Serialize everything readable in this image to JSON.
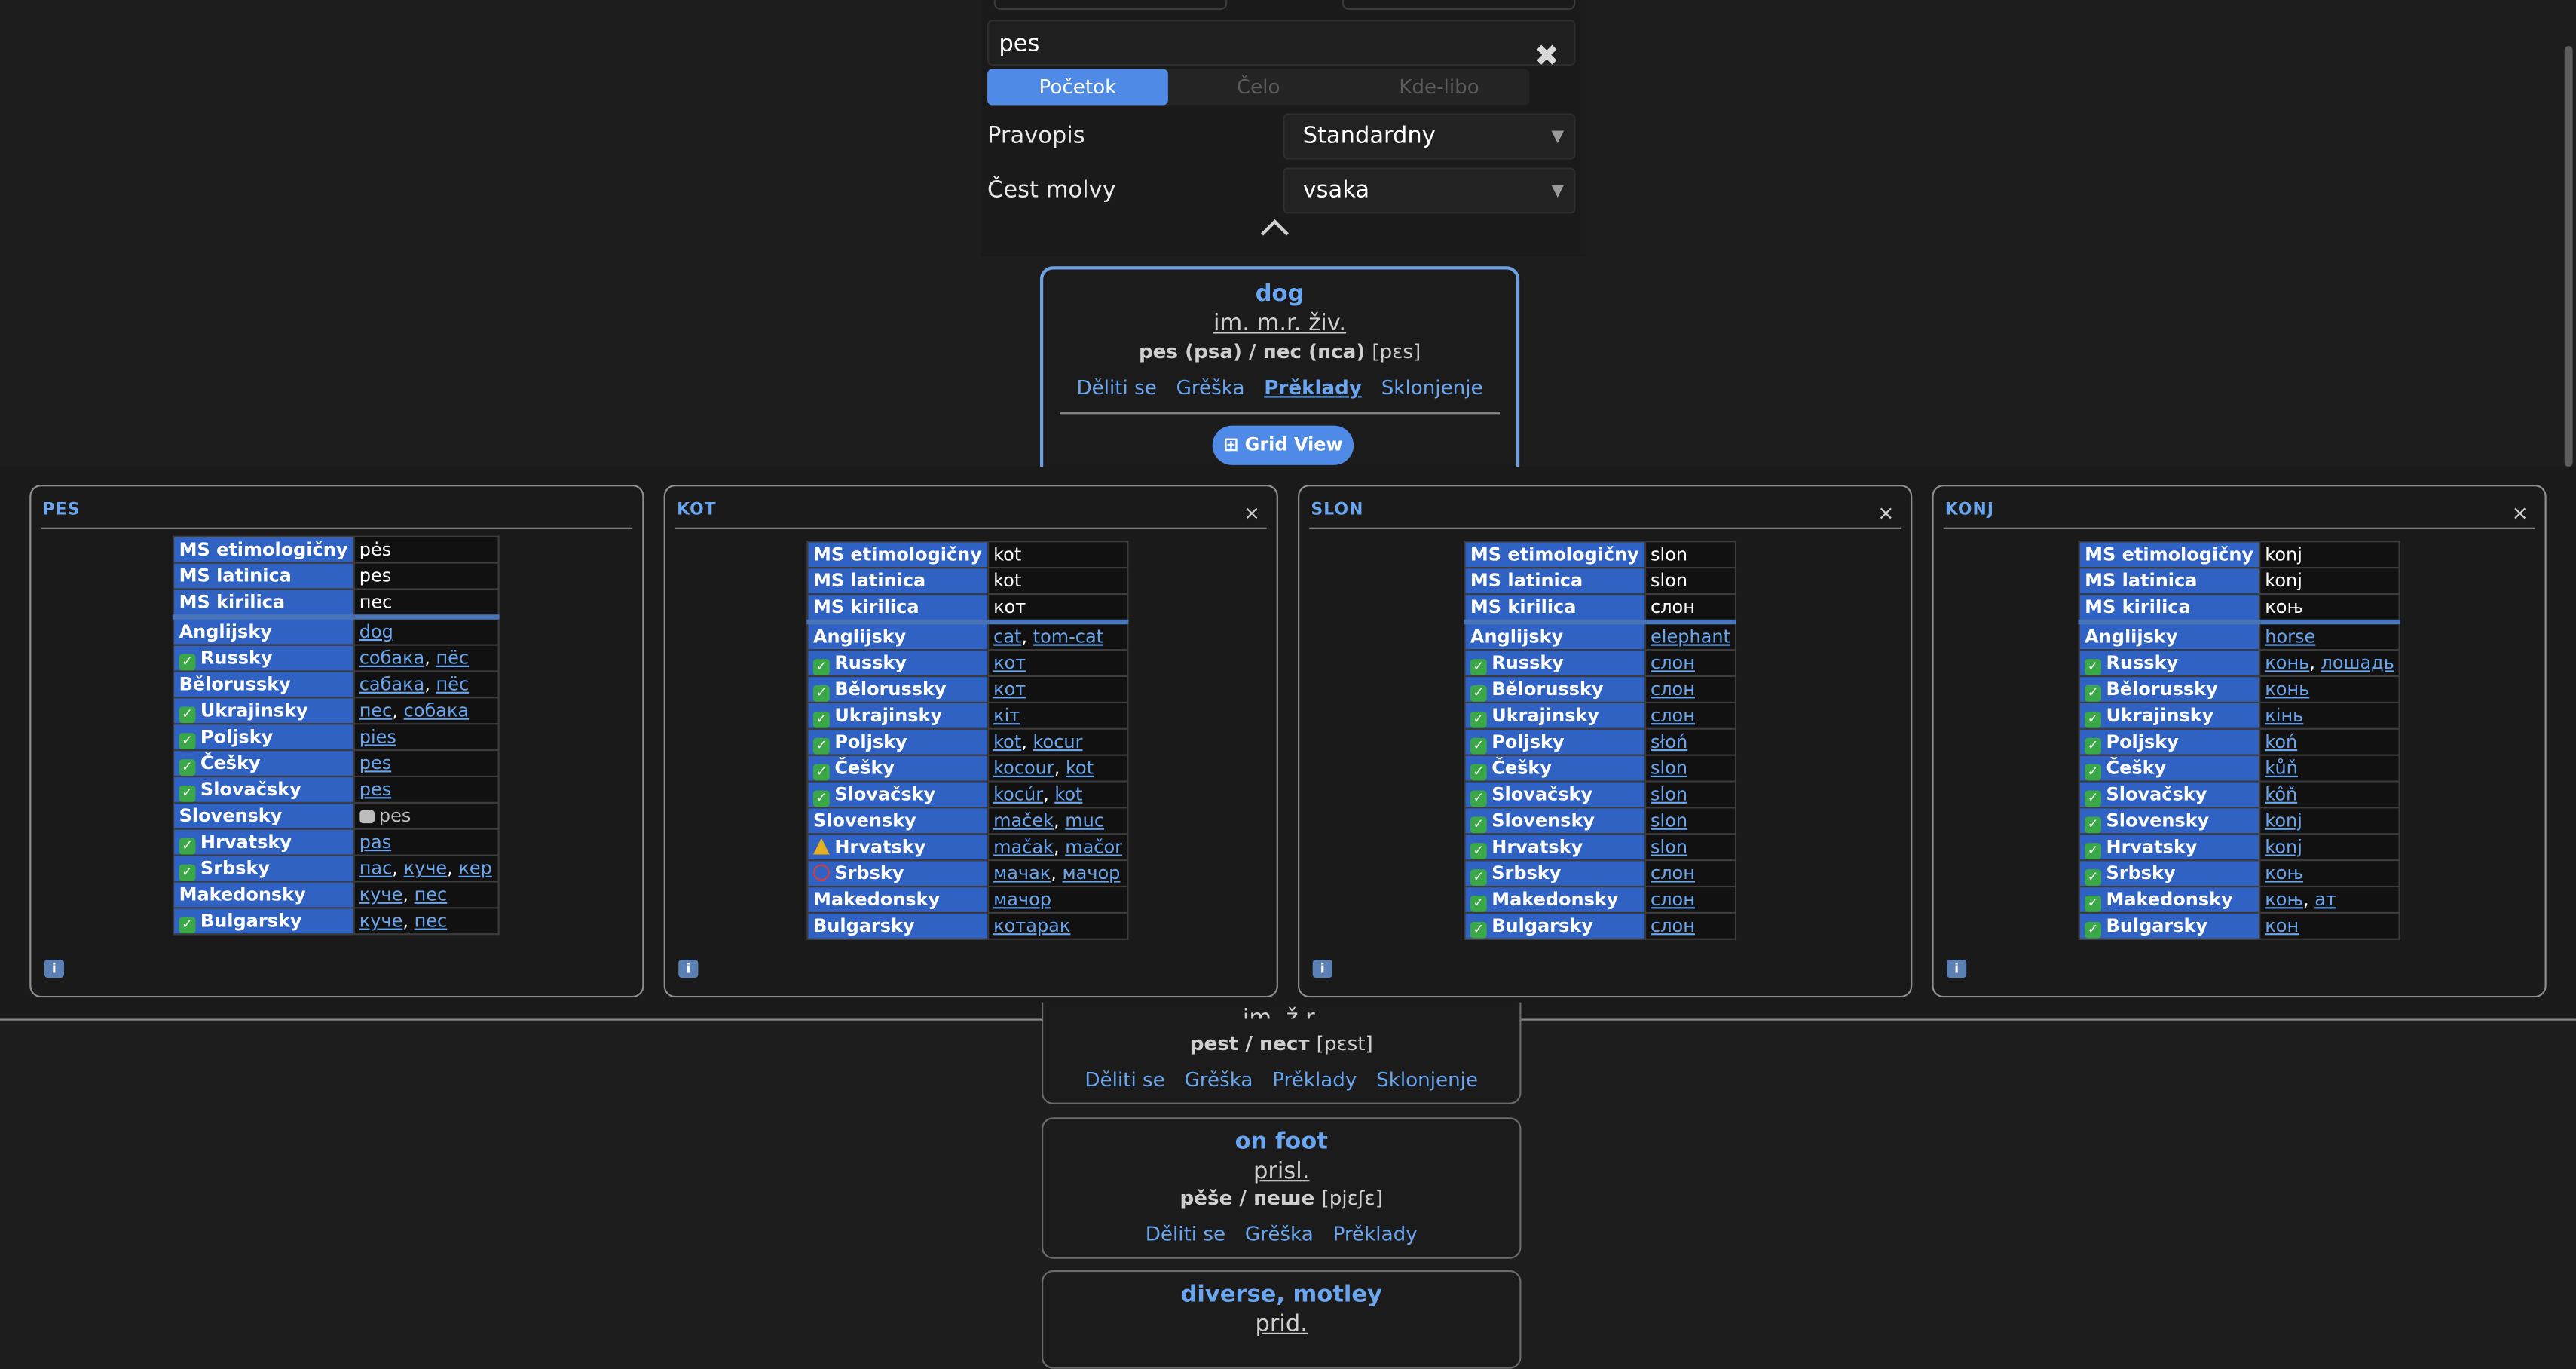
{
  "search": {
    "query": "pes",
    "modes": [
      "Početok",
      "Čelo",
      "Kde-libo"
    ]
  },
  "filters": {
    "pravopis_label": "Pravopis",
    "pravopis_value": "Standardny",
    "cest_label": "Čest molvy",
    "cest_value": "vsaka"
  },
  "colors": {
    "accent": "#4f8be6",
    "link": "#6aa6f0",
    "table_key": "#2f62c2",
    "bg": "#1d1d1d"
  },
  "cards": [
    {
      "title": "dog",
      "pos": "im. m.r. živ.",
      "forms": "pes (psa)  / пес (пса)",
      "ipa": "[pɛs]",
      "links": [
        "Děliti se",
        "Grěška",
        "Prěklady",
        "Sklonjenje"
      ],
      "grid_label": "⊞ Grid View"
    },
    {
      "title": "",
      "pos": "im. ž.r.",
      "forms": "pest  / пест",
      "ipa": "[pɛst]",
      "links": [
        "Děliti se",
        "Grěška",
        "Prěklady",
        "Sklonjenje"
      ]
    },
    {
      "title": "on foot",
      "pos": "prisl.",
      "forms": "pěše  / пеше",
      "ipa": "[pjɛʃɛ]",
      "links": [
        "Děliti se",
        "Grěška",
        "Prěklady"
      ]
    },
    {
      "title": "diverse, motley",
      "pos": "prid."
    }
  ],
  "panels": [
    {
      "name": "PES",
      "close": "",
      "head": [
        [
          "MS etimologičny",
          "pės"
        ],
        [
          "MS latinica",
          "pes"
        ],
        [
          "MS kirilica",
          "пес"
        ]
      ],
      "rows": [
        {
          "lang": "Anglijsky",
          "status": "",
          "values": [
            "dog"
          ]
        },
        {
          "lang": "Russky",
          "status": "check",
          "values": [
            "собака",
            "пёс"
          ]
        },
        {
          "lang": "Bělorussky",
          "status": "",
          "values": [
            "сабака",
            "пёс"
          ]
        },
        {
          "lang": "Ukrajinsky",
          "status": "check",
          "values": [
            "пес",
            "собака"
          ]
        },
        {
          "lang": "Poljsky",
          "status": "check",
          "values": [
            "pies"
          ]
        },
        {
          "lang": "Češky",
          "status": "check",
          "values": [
            "pes"
          ]
        },
        {
          "lang": "Slovačsky",
          "status": "check",
          "values": [
            "pes"
          ]
        },
        {
          "lang": "Slovensky",
          "status": "",
          "values": [],
          "plain": "pes"
        },
        {
          "lang": "Hrvatsky",
          "status": "check",
          "values": [
            "pas"
          ]
        },
        {
          "lang": "Srbsky",
          "status": "check",
          "values": [
            "пас",
            "куче",
            "кер"
          ]
        },
        {
          "lang": "Makedonsky",
          "status": "",
          "values": [
            "куче",
            "пес"
          ]
        },
        {
          "lang": "Bulgarsky",
          "status": "check",
          "values": [
            "куче",
            "пес"
          ]
        }
      ]
    },
    {
      "name": "KOT",
      "close": "×",
      "head": [
        [
          "MS etimologičny",
          "kot"
        ],
        [
          "MS latinica",
          "kot"
        ],
        [
          "MS kirilica",
          "кот"
        ]
      ],
      "rows": [
        {
          "lang": "Anglijsky",
          "status": "",
          "values": [
            "cat",
            "tom-cat"
          ]
        },
        {
          "lang": "Russky",
          "status": "check",
          "values": [
            "кот"
          ]
        },
        {
          "lang": "Bělorussky",
          "status": "check",
          "values": [
            "кот"
          ]
        },
        {
          "lang": "Ukrajinsky",
          "status": "check",
          "values": [
            "кіт"
          ]
        },
        {
          "lang": "Poljsky",
          "status": "check",
          "values": [
            "kot",
            "kocur"
          ]
        },
        {
          "lang": "Češky",
          "status": "check",
          "values": [
            "kocour",
            "kot"
          ]
        },
        {
          "lang": "Slovačsky",
          "status": "check",
          "values": [
            "kocúr",
            "kot"
          ]
        },
        {
          "lang": "Slovensky",
          "status": "",
          "values": [
            "maček",
            "muc"
          ]
        },
        {
          "lang": "Hrvatsky",
          "status": "warn",
          "values": [
            "mačak",
            "mačor"
          ]
        },
        {
          "lang": "Srbsky",
          "status": "no",
          "values": [
            "мачак",
            "мачор"
          ]
        },
        {
          "lang": "Makedonsky",
          "status": "",
          "values": [
            "мачор"
          ]
        },
        {
          "lang": "Bulgarsky",
          "status": "",
          "values": [
            "котарак"
          ]
        }
      ]
    },
    {
      "name": "SLON",
      "close": "×",
      "head": [
        [
          "MS etimologičny",
          "slon"
        ],
        [
          "MS latinica",
          "slon"
        ],
        [
          "MS kirilica",
          "слон"
        ]
      ],
      "rows": [
        {
          "lang": "Anglijsky",
          "status": "",
          "values": [
            "elephant"
          ]
        },
        {
          "lang": "Russky",
          "status": "check",
          "values": [
            "слон"
          ]
        },
        {
          "lang": "Bělorussky",
          "status": "check",
          "values": [
            "слон"
          ]
        },
        {
          "lang": "Ukrajinsky",
          "status": "check",
          "values": [
            "слон"
          ]
        },
        {
          "lang": "Poljsky",
          "status": "check",
          "values": [
            "słoń"
          ]
        },
        {
          "lang": "Češky",
          "status": "check",
          "values": [
            "slon"
          ]
        },
        {
          "lang": "Slovačsky",
          "status": "check",
          "values": [
            "slon"
          ]
        },
        {
          "lang": "Slovensky",
          "status": "check",
          "values": [
            "slon"
          ]
        },
        {
          "lang": "Hrvatsky",
          "status": "check",
          "values": [
            "slon"
          ]
        },
        {
          "lang": "Srbsky",
          "status": "check",
          "values": [
            "слон"
          ]
        },
        {
          "lang": "Makedonsky",
          "status": "check",
          "values": [
            "слон"
          ]
        },
        {
          "lang": "Bulgarsky",
          "status": "check",
          "values": [
            "слон"
          ]
        }
      ]
    },
    {
      "name": "KONJ",
      "close": "×",
      "head": [
        [
          "MS etimologičny",
          "konj"
        ],
        [
          "MS latinica",
          "konj"
        ],
        [
          "MS kirilica",
          "коњ"
        ]
      ],
      "rows": [
        {
          "lang": "Anglijsky",
          "status": "",
          "values": [
            "horse"
          ]
        },
        {
          "lang": "Russky",
          "status": "check",
          "values": [
            "конь",
            "лошадь"
          ]
        },
        {
          "lang": "Bělorussky",
          "status": "check",
          "values": [
            "конь"
          ]
        },
        {
          "lang": "Ukrajinsky",
          "status": "check",
          "values": [
            "кінь"
          ]
        },
        {
          "lang": "Poljsky",
          "status": "check",
          "values": [
            "koń"
          ]
        },
        {
          "lang": "Češky",
          "status": "check",
          "values": [
            "kůň"
          ]
        },
        {
          "lang": "Slovačsky",
          "status": "check",
          "values": [
            "kôň"
          ]
        },
        {
          "lang": "Slovensky",
          "status": "check",
          "values": [
            "konj"
          ]
        },
        {
          "lang": "Hrvatsky",
          "status": "check",
          "values": [
            "konj"
          ]
        },
        {
          "lang": "Srbsky",
          "status": "check",
          "values": [
            "коњ"
          ]
        },
        {
          "lang": "Makedonsky",
          "status": "check",
          "values": [
            "коњ",
            "ат"
          ]
        },
        {
          "lang": "Bulgarsky",
          "status": "check",
          "values": [
            "кон"
          ]
        }
      ]
    }
  ]
}
